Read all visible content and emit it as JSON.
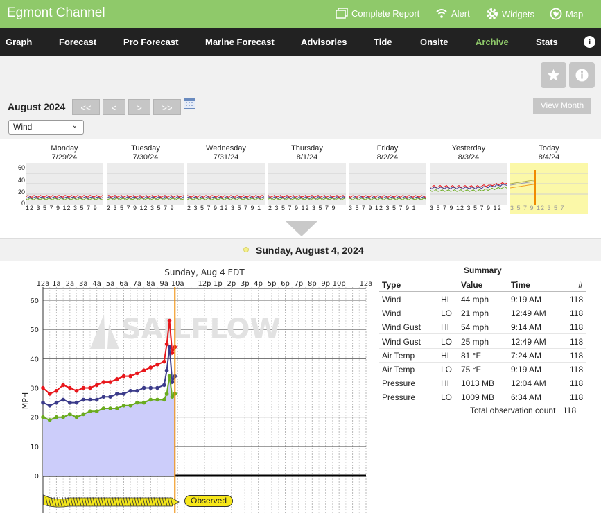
{
  "app": {
    "title": "Egmont Channel",
    "top_links": [
      {
        "label": "Complete Report",
        "icon": "report-icon"
      },
      {
        "label": "Alert",
        "icon": "wifi-icon"
      },
      {
        "label": "Widgets",
        "icon": "gear-icon"
      },
      {
        "label": "Map",
        "icon": "map-icon"
      }
    ]
  },
  "nav": {
    "items": [
      "Graph",
      "Forecast",
      "Pro Forecast",
      "Marine Forecast",
      "Advisories",
      "Tide",
      "Onsite",
      "Archive",
      "Stats"
    ],
    "active": "Archive"
  },
  "toolbar": {
    "buttons": [
      "star-icon",
      "info-icon"
    ]
  },
  "archive": {
    "month": "August 2024",
    "nav": [
      "<<",
      "<",
      ">",
      ">>"
    ],
    "view_month": "View Month",
    "select_value": "Wind"
  },
  "week": {
    "days": [
      {
        "name": "Monday",
        "date": "7/29/24",
        "ticks": "12 3 5 7 9 12 3 5 7 9"
      },
      {
        "name": "Tuesday",
        "date": "7/30/24",
        "ticks": "2 3 5 7 9 12 3 5 7 9"
      },
      {
        "name": "Wednesday",
        "date": "7/31/24",
        "ticks": "2 3 5 7 9 12 3 5 7 9 1"
      },
      {
        "name": "Thursday",
        "date": "8/1/24",
        "ticks": "2 3 5 7 9 12 3 5 7 9"
      },
      {
        "name": "Friday",
        "date": "8/2/24",
        "ticks": "3 5 7 9 12 3 5 7 9 1"
      },
      {
        "name": "Yesterday",
        "date": "8/3/24",
        "ticks": "3 5 7 9 12 3 5 7 9 12"
      },
      {
        "name": "Today",
        "date": "8/4/24",
        "ticks": "3 5 7 9 12 3 5 7"
      }
    ],
    "y_ticks": [
      "60",
      "40",
      "20",
      "0"
    ]
  },
  "selected_date": "Sunday, August 4, 2024",
  "chart_data": {
    "type": "line",
    "title": "Sunday, Aug 4 EDT",
    "ylabel": "MPH",
    "x_ticks": [
      "12a",
      "1a",
      "2a",
      "3a",
      "4a",
      "5a",
      "6a",
      "7a",
      "8a",
      "9a",
      "10a",
      "12p",
      "1p",
      "2p",
      "3p",
      "4p",
      "5p",
      "6p",
      "7p",
      "8p",
      "9p",
      "10p",
      "12a"
    ],
    "y_ticks": [
      "60",
      "50",
      "40",
      "30",
      "20",
      "10",
      "0"
    ],
    "ylim": [
      0,
      60
    ],
    "x": [
      0,
      0.5,
      1,
      1.5,
      2,
      2.5,
      3,
      3.5,
      4,
      4.5,
      5,
      5.5,
      6,
      6.5,
      7,
      7.5,
      8,
      8.5,
      9,
      9.2,
      9.4,
      9.6,
      9.8
    ],
    "series": [
      {
        "values": [
          30,
          28,
          29,
          31,
          30,
          29,
          30,
          30,
          31,
          32,
          32,
          33,
          34,
          34,
          35,
          36,
          37,
          38,
          39,
          45,
          53,
          42,
          44
        ],
        "color": "#e8161b"
      },
      {
        "values": [
          25,
          24,
          25,
          26,
          25,
          25,
          26,
          26,
          26,
          27,
          27,
          28,
          28,
          29,
          29,
          30,
          30,
          30,
          31,
          36,
          44,
          32,
          34
        ],
        "color": "#3b3b8a"
      },
      {
        "values": [
          20,
          19,
          20,
          20,
          21,
          20,
          21,
          22,
          22,
          23,
          23,
          23,
          24,
          24,
          25,
          25,
          26,
          26,
          26,
          28,
          34,
          27,
          28
        ],
        "color": "#6aab1f"
      }
    ],
    "current_hour": 9.8,
    "watermark": "SAILFLOW",
    "status_label": "Observed",
    "grid": true
  },
  "summary": {
    "title": "Summary",
    "headers": [
      "Type",
      "Value",
      "Time",
      "#"
    ],
    "rows": [
      {
        "type": "Wind",
        "hl": "HI",
        "value": "44 mph",
        "time": "9:19 AM",
        "n": "118"
      },
      {
        "type": "Wind",
        "hl": "LO",
        "value": "21 mph",
        "time": "12:49 AM",
        "n": "118"
      },
      {
        "type": "Wind Gust",
        "hl": "HI",
        "value": "54 mph",
        "time": "9:14 AM",
        "n": "118"
      },
      {
        "type": "Wind Gust",
        "hl": "LO",
        "value": "25 mph",
        "time": "12:49 AM",
        "n": "118"
      },
      {
        "type": "Air Temp",
        "hl": "HI",
        "value": "81 °F",
        "time": "7:24 AM",
        "n": "118"
      },
      {
        "type": "Air Temp",
        "hl": "LO",
        "value": "75 °F",
        "time": "9:19 AM",
        "n": "118"
      },
      {
        "type": "Pressure",
        "hl": "HI",
        "value": "1013 MB",
        "time": "12:04 AM",
        "n": "118"
      },
      {
        "type": "Pressure",
        "hl": "LO",
        "value": "1009 MB",
        "time": "6:34 AM",
        "n": "118"
      }
    ],
    "total_label": "Total observation count",
    "total": "118"
  }
}
